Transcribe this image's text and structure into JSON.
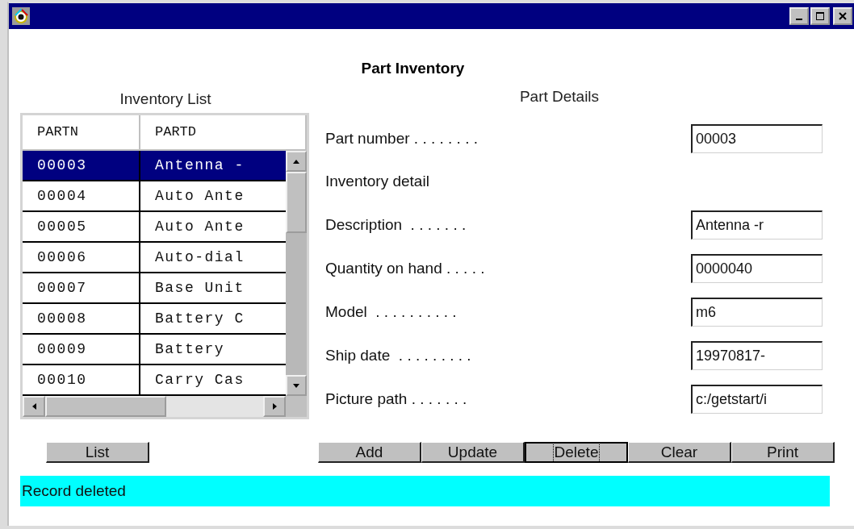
{
  "window": {
    "title": "Part Inventory"
  },
  "inventory_list": {
    "heading": "Inventory List",
    "columns": [
      "PARTN",
      "PARTD"
    ],
    "rows": [
      {
        "cells": [
          "00003",
          "Antenna -"
        ],
        "selected": true
      },
      {
        "cells": [
          "00004",
          "Auto Ante"
        ],
        "selected": false
      },
      {
        "cells": [
          "00005",
          "Auto Ante"
        ],
        "selected": false
      },
      {
        "cells": [
          "00006",
          "Auto-dial"
        ],
        "selected": false
      },
      {
        "cells": [
          "00007",
          "Base Unit"
        ],
        "selected": false
      },
      {
        "cells": [
          "00008",
          "Battery C"
        ],
        "selected": false
      },
      {
        "cells": [
          "00009",
          "Battery"
        ],
        "selected": false
      },
      {
        "cells": [
          "00010",
          "Carry Cas"
        ],
        "selected": false
      }
    ]
  },
  "part_details": {
    "heading": "Part Details",
    "rows": [
      {
        "kind": "field",
        "label": "Part number . . . . . . . .",
        "value": "00003"
      },
      {
        "kind": "heading",
        "label": "Inventory detail"
      },
      {
        "kind": "field",
        "label": "Description  . . . . . . .",
        "value": "Antenna -r"
      },
      {
        "kind": "field",
        "label": "Quantity on hand . . . . .",
        "value": "0000040"
      },
      {
        "kind": "field",
        "label": "Model  . . . . . . . . . .",
        "value": "m6"
      },
      {
        "kind": "field",
        "label": "Ship date  . . . . . . . . .",
        "value": "19970817-"
      },
      {
        "kind": "field",
        "label": "Picture path . . . . . . .",
        "value": "c:/getstart/i"
      }
    ]
  },
  "list_button": {
    "label": "List",
    "focused": false
  },
  "action_buttons": [
    {
      "label": "Add",
      "focused": false
    },
    {
      "label": "Update",
      "focused": false
    },
    {
      "label": "Delete",
      "focused": true
    },
    {
      "label": "Clear",
      "focused": false
    },
    {
      "label": "Print",
      "focused": false
    }
  ],
  "status_bar": "Record deleted"
}
